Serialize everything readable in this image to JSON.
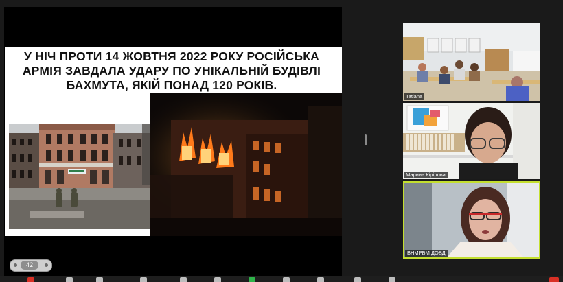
{
  "slide": {
    "title_line1": "У НІЧ ПРОТИ 14 ЖОВТНЯ 2022 РОКУ РОСІЙСЬКА",
    "title_line2": "АРМІЯ ЗАВДАЛА УДАРУ ПО УНІКАЛЬНІЙ БУДІВЛІ",
    "title_line3": "БАХМУТА, ЯКІЙ ПОНАД 120 РОКІВ.",
    "page_number": "42"
  },
  "participants": [
    {
      "name": "Tatiana"
    },
    {
      "name": "Марина Кірілова"
    },
    {
      "name": "ВНМРБМ ДОВД"
    }
  ],
  "colors": {
    "active_speaker_border": "#c4df2f",
    "fire": "#ff7a1a",
    "toolbar_red": "#d93025",
    "toolbar_green": "#2fb34a"
  },
  "toolbar": {
    "icons": [
      "mic-icon",
      "video-icon",
      "security-icon",
      "participants-icon",
      "chat-icon",
      "share-icon",
      "record-icon",
      "reactions-icon",
      "apps-icon",
      "more-icon",
      "leave-icon"
    ]
  }
}
